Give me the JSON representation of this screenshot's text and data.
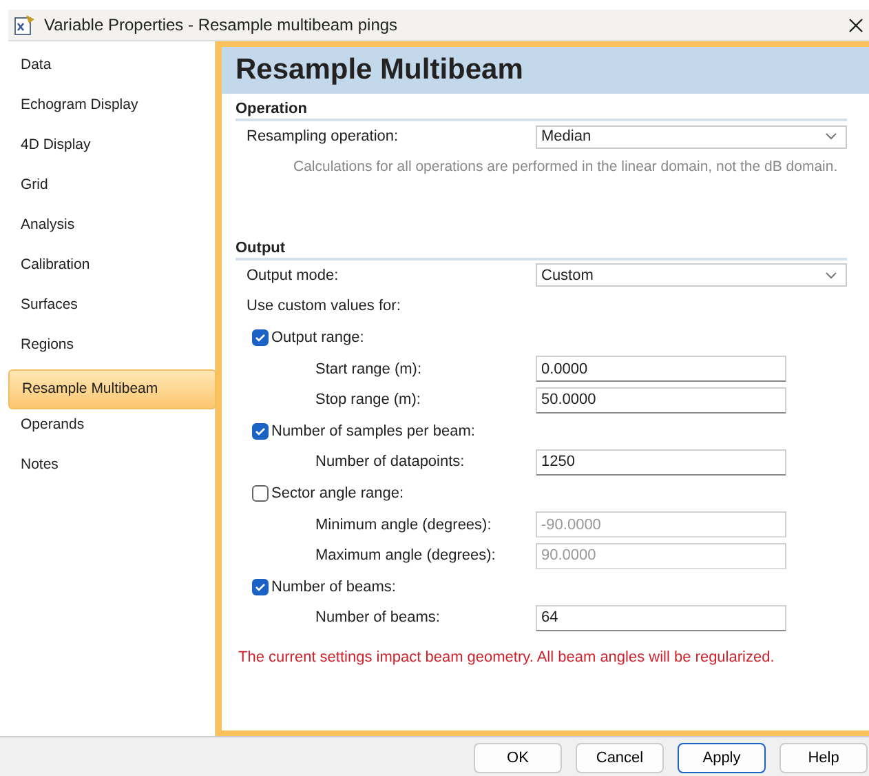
{
  "window": {
    "title": "Variable Properties - Resample multibeam pings"
  },
  "sidebar": {
    "items": [
      {
        "label": "Data",
        "selected": false
      },
      {
        "label": "Echogram Display",
        "selected": false
      },
      {
        "label": "4D Display",
        "selected": false
      },
      {
        "label": "Grid",
        "selected": false
      },
      {
        "label": "Analysis",
        "selected": false
      },
      {
        "label": "Calibration",
        "selected": false
      },
      {
        "label": "Surfaces",
        "selected": false
      },
      {
        "label": "Regions",
        "selected": false
      },
      {
        "label": "Resample Multibeam",
        "selected": true
      },
      {
        "label": "Operands",
        "selected": false
      },
      {
        "label": "Notes",
        "selected": false
      }
    ]
  },
  "page": {
    "title": "Resample Multibeam",
    "sections": [
      {
        "heading": "Operation",
        "rows": [
          {
            "kind": "dropdown",
            "label": "Resampling operation:",
            "value": "Median"
          },
          {
            "kind": "note",
            "text": "Calculations for all operations are performed in the linear domain, not the dB domain."
          }
        ]
      },
      {
        "heading": "Output",
        "rows": [
          {
            "kind": "dropdown",
            "label": "Output mode:",
            "value": "Custom"
          },
          {
            "kind": "text",
            "text": "Use custom values for:"
          },
          {
            "kind": "checkbox",
            "label": "Output range:",
            "checked": true
          },
          {
            "kind": "field",
            "label": "Start range (m):",
            "value": "0.0000",
            "disabled": false
          },
          {
            "kind": "field",
            "label": "Stop range (m):",
            "value": "50.0000",
            "disabled": false
          },
          {
            "kind": "checkbox",
            "label": "Number of samples per beam:",
            "checked": true
          },
          {
            "kind": "field",
            "label": "Number of datapoints:",
            "value": "1250",
            "disabled": false
          },
          {
            "kind": "checkbox",
            "label": "Sector angle range:",
            "checked": false
          },
          {
            "kind": "field",
            "label": "Minimum angle (degrees):",
            "value": "-90.0000",
            "disabled": true
          },
          {
            "kind": "field",
            "label": "Maximum angle (degrees):",
            "value": "90.0000",
            "disabled": true
          },
          {
            "kind": "checkbox",
            "label": "Number of beams:",
            "checked": true
          },
          {
            "kind": "field",
            "label": "Number of beams:",
            "value": "64",
            "disabled": false
          }
        ]
      }
    ],
    "warning": "The current settings impact beam geometry. All beam angles will be regularized."
  },
  "buttons": [
    {
      "label": "OK",
      "focused": false
    },
    {
      "label": "Cancel",
      "focused": false
    },
    {
      "label": "Apply",
      "focused": true
    },
    {
      "label": "Help",
      "focused": false
    }
  ]
}
